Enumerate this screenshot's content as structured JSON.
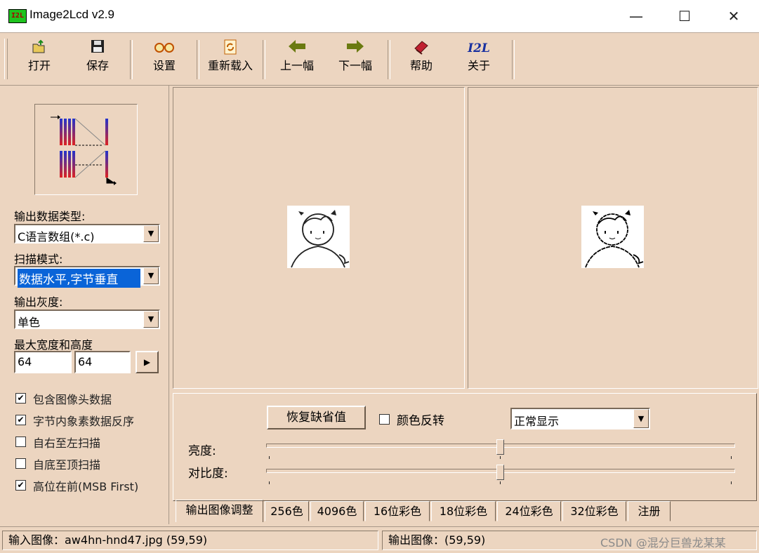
{
  "window": {
    "title": "Image2Lcd v2.9",
    "icon_text": "I2L",
    "minimize": "—",
    "maximize": "☐",
    "close": "✕"
  },
  "toolbar": {
    "buttons": [
      {
        "label": "打开",
        "icon": "open-folder-icon"
      },
      {
        "label": "保存",
        "icon": "floppy-disk-icon"
      },
      {
        "label": "设置",
        "icon": "glasses-icon"
      },
      {
        "label": "重新载入",
        "icon": "reload-icon"
      },
      {
        "label": "上一幅",
        "icon": "arrow-left-icon"
      },
      {
        "label": "下一幅",
        "icon": "arrow-right-icon"
      },
      {
        "label": "帮助",
        "icon": "help-book-icon"
      },
      {
        "label": "关于",
        "icon_text": "I2L",
        "icon": "about-logo-icon"
      }
    ]
  },
  "left": {
    "output_type": {
      "label": "输出数据类型:",
      "value": "C语言数组(*.c)"
    },
    "scan_mode": {
      "label": "扫描模式:",
      "value": "数据水平,字节垂直"
    },
    "gray": {
      "label": "输出灰度:",
      "value": "单色"
    },
    "size": {
      "label": "最大宽度和高度",
      "width": "64",
      "height": "64",
      "apply": "▶"
    },
    "checks": [
      {
        "label": "包含图像头数据",
        "checked": true
      },
      {
        "label": "字节内象素数据反序",
        "checked": true
      },
      {
        "label": "自右至左扫描",
        "checked": false
      },
      {
        "label": "自底至顶扫描",
        "checked": false
      },
      {
        "label": "高位在前(MSB First)",
        "checked": true
      }
    ]
  },
  "adjust": {
    "reset_button": "恢复缺省值",
    "invert_label": "颜色反转",
    "invert_checked": false,
    "display_mode": "正常显示",
    "brightness_label": "亮度:",
    "contrast_label": "对比度:",
    "brightness_level": 0.5,
    "contrast_level": 0.5
  },
  "tabs": [
    "输出图像调整",
    "256色",
    "4096色",
    "16位彩色",
    "18位彩色",
    "24位彩色",
    "32位彩色",
    "注册"
  ],
  "active_tab": "输出图像调整",
  "status": {
    "input": "输入图像：aw4hn-hnd47.jpg (59,59)",
    "output": "输出图像：(59,59)",
    "watermark": "CSDN @混分巨兽龙某某"
  },
  "colors": {
    "window_bg": "#ecd5c0",
    "selection": "#0a64d8",
    "app_icon": "#1ec31e"
  }
}
